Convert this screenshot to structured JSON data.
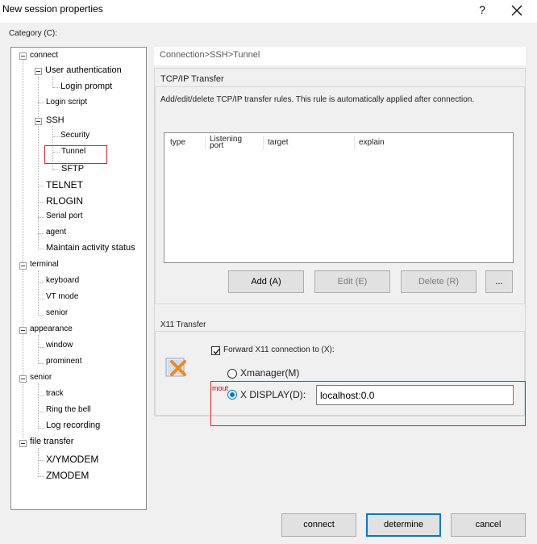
{
  "window": {
    "title": "New session properties",
    "help_glyph": "?",
    "close_icon": "close-icon"
  },
  "category_label": "Category (C):",
  "tree": {
    "items": [
      {
        "label": "connect"
      },
      {
        "label": "User authentication"
      },
      {
        "label": "Login prompt"
      },
      {
        "label": "Login script"
      },
      {
        "label": "SSH"
      },
      {
        "label": "Security"
      },
      {
        "label": "Tunnel",
        "selected": true
      },
      {
        "label": "SFTP"
      },
      {
        "label": "TELNET"
      },
      {
        "label": "RLOGIN"
      },
      {
        "label": "Serial port"
      },
      {
        "label": "agent"
      },
      {
        "label": "Maintain activity status"
      },
      {
        "label": "terminal"
      },
      {
        "label": "keyboard"
      },
      {
        "label": "VT mode"
      },
      {
        "label": "senior"
      },
      {
        "label": "appearance"
      },
      {
        "label": "window"
      },
      {
        "label": "prominent"
      },
      {
        "label": "senior"
      },
      {
        "label": "track"
      },
      {
        "label": "Ring the bell"
      },
      {
        "label": "Log recording"
      },
      {
        "label": "file transfer"
      },
      {
        "label": "X/YMODEM"
      },
      {
        "label": "ZMODEM"
      }
    ]
  },
  "breadcrumb": "Connection>SSH>Tunnel",
  "tcpip": {
    "title": "TCP/IP Transfer",
    "description": "Add/edit/delete TCP/IP transfer rules. This rule is automatically applied after connection.",
    "columns": [
      "type",
      "Listening port",
      "target",
      "explain"
    ],
    "buttons": {
      "add": "Add (A)",
      "edit": "Edit (E)",
      "delete": "Delete (R)",
      "more": "..."
    }
  },
  "x11": {
    "title": "X11 Transfer",
    "icon": "x11-icon",
    "forward_label": "Forward X11 connection to (X):",
    "forward_checked": true,
    "xmanager_label": "Xmanager(M)",
    "xdisplay_label": "X DISPLAY(D):",
    "xdisplay_selected": true,
    "display_value": "localhost:0.0",
    "annotation_text": "mout"
  },
  "footer": {
    "connect": "connect",
    "determine": "determine",
    "cancel": "cancel"
  },
  "colors": {
    "accent": "#0078d7",
    "highlight_box": "#e02020"
  }
}
